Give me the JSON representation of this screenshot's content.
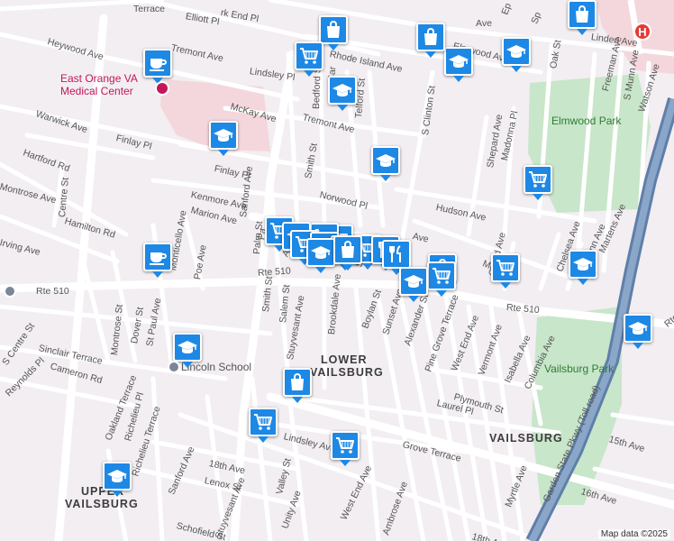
{
  "map": {
    "colors": {
      "background": "#f2eef2",
      "park": "#c8e6c9",
      "medical": "#f4d7dc",
      "road": "#ffffff",
      "highway": "#5f7fa8",
      "highway_fill": "#8aa6c9",
      "pin": "#1e88e5"
    },
    "credit": "Map data ©2025",
    "areas": [
      {
        "id": "lower-vailsburg-1",
        "text": "LOWER"
      },
      {
        "id": "lower-vailsburg-2",
        "text": "VAILSBURG"
      },
      {
        "id": "vailsburg",
        "text": "VAILSBURG"
      },
      {
        "id": "upper-vailsburg-1",
        "text": "UPPER"
      },
      {
        "id": "upper-vailsburg-2",
        "text": "VAILSBURG"
      }
    ],
    "pois": [
      {
        "id": "east-orange-va-1",
        "text": "East Orange VA",
        "color": "#c2185b"
      },
      {
        "id": "east-orange-va-2",
        "text": "Medical Center",
        "color": "#c2185b"
      },
      {
        "id": "lincoln-school",
        "text": "Lincoln School",
        "color": "#555555"
      },
      {
        "id": "elmwood-park",
        "text": "Elmwood Park",
        "color": "#2e7d32"
      },
      {
        "id": "vailsburg-park",
        "text": "Vailsburg Park",
        "color": "#2e7d32"
      }
    ],
    "streets": [
      "Terrace",
      "Elliott Pl",
      "rk End Pl",
      "Heywood Ave",
      "Tremont Ave",
      "Lindsley Pl",
      "Rhode Island Ave",
      "Elmwood Ave",
      "Linden Ave",
      "Oak St",
      "Freeman Ave",
      "S Munn Ave",
      "Watson Ave",
      "McKay Ave",
      "Tremont Ave",
      "Warwick Ave",
      "Finlay Pl",
      "Finlay Pl",
      "Hartford Rd",
      "Centre St",
      "Sanford Ave",
      "Smith St",
      "Bedford St",
      "Telford St",
      "S Clinton St",
      "Madonna Pl",
      "Shepard Ave",
      "Norwood Pl",
      "Hudson Ave",
      "Kenmore Ave",
      "Marion Ave",
      "Montrose Ave",
      "Hamilton Rd",
      "Irving Ave",
      "Poe Ave",
      "Monticello Ave",
      "Rte 510",
      "Rte 510",
      "Rte 510",
      "Rte 510",
      "Palm St",
      "Smith St",
      "Salem St",
      "Stuyvesant Ave",
      "Brookdale Ave",
      "Boylan St",
      "Sunset Ave",
      "Alexander St",
      "Pine Grove Terrace",
      "West End Ave",
      "Vermont Ave",
      "Isabella Ave",
      "Columbia Ave",
      "Grand Ave",
      "Chelsea Ave",
      "N Munn Ave",
      "Martens Ave",
      "Montrose St",
      "Dover St",
      "St Paul Ave",
      "Sinclair Terrace",
      "S Centre St",
      "Cameron Rd",
      "Reynolds Pl",
      "Oakland Terrace",
      "Richelieu Pl",
      "Richelieu Terrace",
      "Sanford Ave",
      "18th Ave",
      "Lindsley Ave",
      "Laurel Pl",
      "Plymouth St",
      "Grove Terrace",
      "Lenox St",
      "Schofield St",
      "Stuyvesant Ave",
      "Valley St",
      "Unity Ave",
      "West End Ave",
      "Ambrose Ave",
      "18th Ave",
      "Myrtle Ave",
      "15th Ave",
      "16th Ave",
      "Garden State Pkwy (Toll road)",
      "Moore St",
      "Ave",
      "Ep",
      "Sp",
      "Hi",
      "S Smith",
      "S",
      "Ave",
      "St",
      "Bo",
      "Sar",
      "Av",
      "Pa"
    ],
    "markers": [
      {
        "type": "bag",
        "icon": "shopping-bag-icon"
      },
      {
        "type": "cart",
        "icon": "shopping-cart-icon"
      },
      {
        "type": "school",
        "icon": "graduation-cap-icon"
      },
      {
        "type": "cart",
        "icon": "shopping-cart-icon"
      },
      {
        "type": "school",
        "icon": "graduation-cap-icon"
      },
      {
        "type": "bag",
        "icon": "shopping-bag-icon"
      },
      {
        "type": "school",
        "icon": "graduation-cap-icon"
      },
      {
        "type": "school",
        "icon": "graduation-cap-icon"
      },
      {
        "type": "bag",
        "icon": "shopping-bag-icon"
      },
      {
        "type": "cafe",
        "icon": "coffee-cup-icon"
      },
      {
        "type": "school",
        "icon": "graduation-cap-icon"
      },
      {
        "type": "school",
        "icon": "graduation-cap-icon"
      },
      {
        "type": "cart",
        "icon": "shopping-cart-icon"
      },
      {
        "type": "cart",
        "icon": "shopping-cart-icon"
      },
      {
        "type": "school",
        "icon": "graduation-cap-icon"
      },
      {
        "type": "cart",
        "icon": "shopping-cart-icon"
      },
      {
        "type": "cart",
        "icon": "shopping-cart-icon"
      },
      {
        "type": "school",
        "icon": "graduation-cap-icon"
      },
      {
        "type": "cart",
        "icon": "shopping-cart-icon"
      },
      {
        "type": "school",
        "icon": "graduation-cap-icon"
      },
      {
        "type": "bag",
        "icon": "shopping-bag-icon"
      },
      {
        "type": "restaurant",
        "icon": "fork-knife-icon"
      },
      {
        "type": "restaurant",
        "icon": "fork-knife-icon"
      },
      {
        "type": "bag",
        "icon": "shopping-bag-icon"
      },
      {
        "type": "cart",
        "icon": "shopping-cart-icon"
      },
      {
        "type": "school",
        "icon": "graduation-cap-icon"
      },
      {
        "type": "cart",
        "icon": "shopping-cart-icon"
      },
      {
        "type": "cart",
        "icon": "shopping-cart-icon"
      },
      {
        "type": "cafe",
        "icon": "coffee-cup-icon"
      },
      {
        "type": "school",
        "icon": "graduation-cap-icon"
      },
      {
        "type": "bag",
        "icon": "shopping-bag-icon"
      },
      {
        "type": "cart",
        "icon": "shopping-cart-icon"
      },
      {
        "type": "cart",
        "icon": "shopping-cart-icon"
      },
      {
        "type": "school",
        "icon": "graduation-cap-icon"
      },
      {
        "type": "school",
        "icon": "graduation-cap-icon"
      }
    ]
  }
}
